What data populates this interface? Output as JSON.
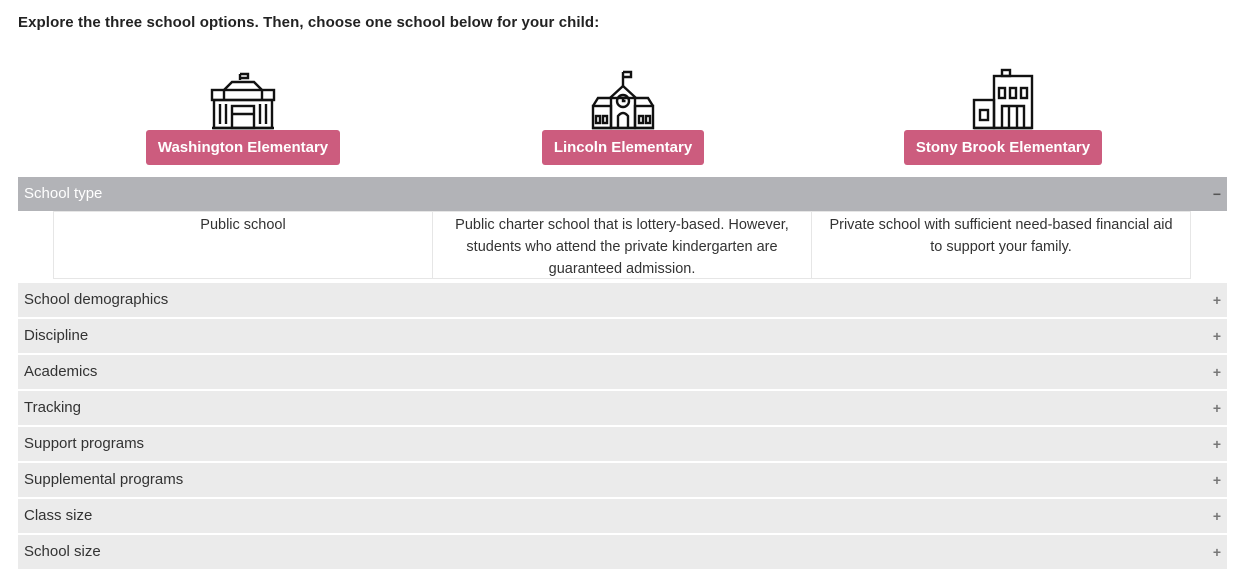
{
  "instruction": "Explore the three school options. Then, choose one school below for your child:",
  "schools": [
    {
      "name": "Washington Elementary",
      "icon": "government-building-icon"
    },
    {
      "name": "Lincoln Elementary",
      "icon": "schoolhouse-clock-icon"
    },
    {
      "name": "Stony Brook Elementary",
      "icon": "office-building-icon"
    }
  ],
  "accent_color": "#cc5c7e",
  "sections": [
    {
      "title": "School type",
      "toggle": "−",
      "expanded": true,
      "cells": [
        "Public school",
        "Public charter school that is lottery-based. However, students who attend the private kindergarten are guaranteed admission.",
        "Private school with sufficient need-based financial aid to support your family."
      ]
    },
    {
      "title": "School demographics",
      "toggle": "+",
      "expanded": false
    },
    {
      "title": "Discipline",
      "toggle": "+",
      "expanded": false
    },
    {
      "title": "Academics",
      "toggle": "+",
      "expanded": false
    },
    {
      "title": "Tracking",
      "toggle": "+",
      "expanded": false
    },
    {
      "title": "Support programs",
      "toggle": "+",
      "expanded": false
    },
    {
      "title": "Supplemental programs",
      "toggle": "+",
      "expanded": false
    },
    {
      "title": "Class size",
      "toggle": "+",
      "expanded": false
    },
    {
      "title": "School size",
      "toggle": "+",
      "expanded": false
    }
  ]
}
